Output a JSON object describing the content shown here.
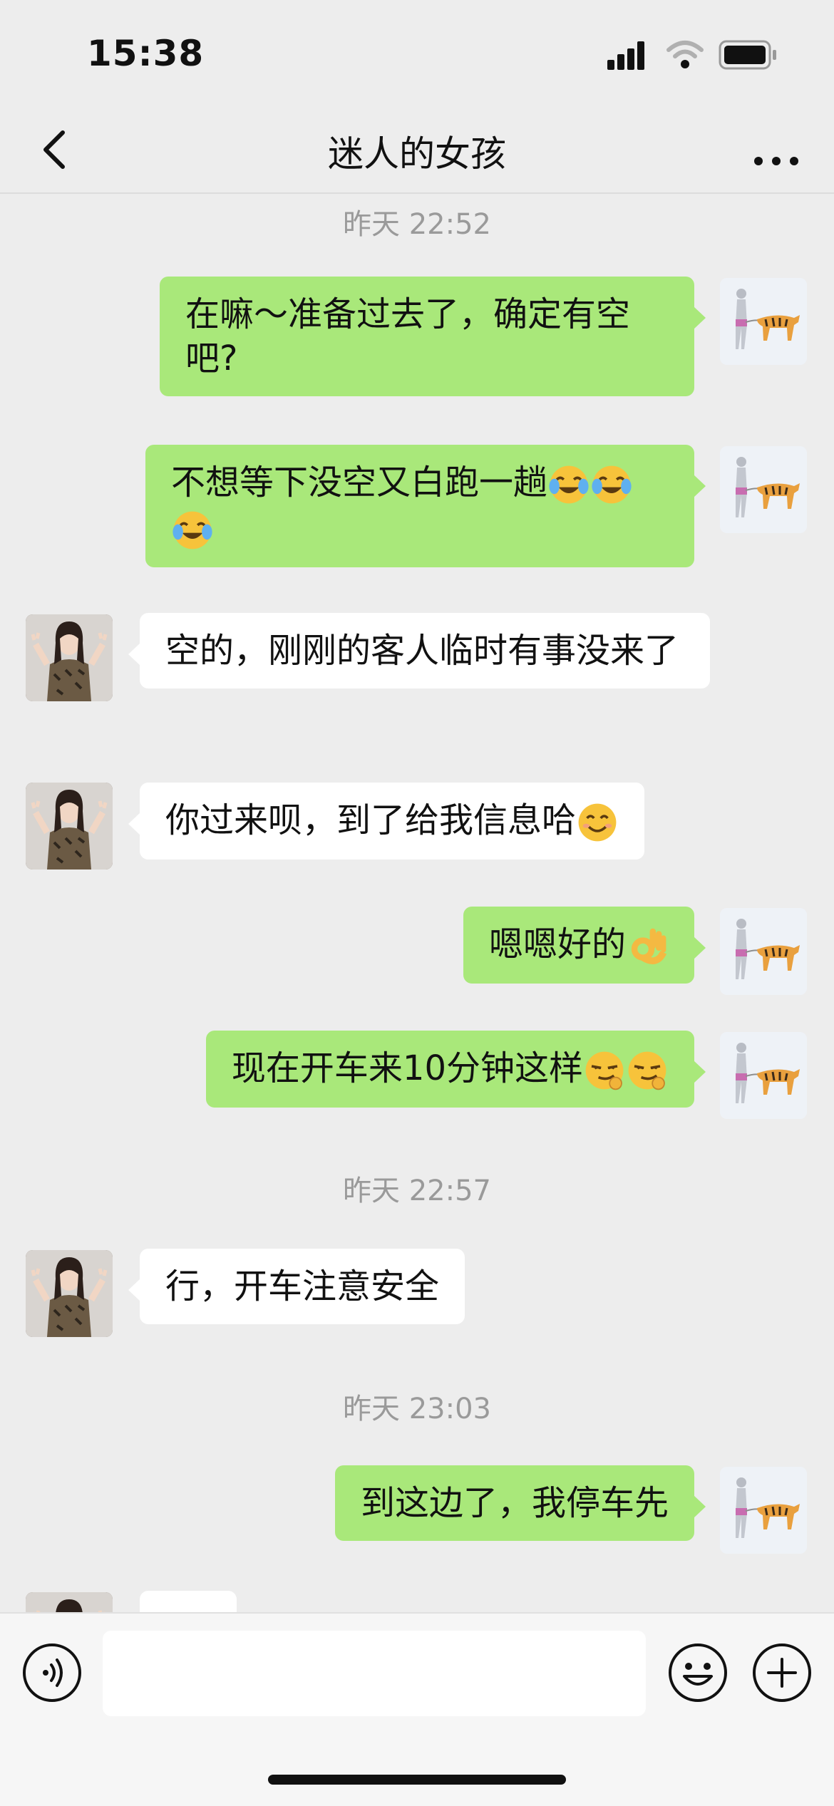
{
  "status_bar": {
    "time": "15:38",
    "signal_icon": "signal-bars-icon",
    "wifi_icon": "wifi-icon",
    "battery_icon": "battery-icon"
  },
  "header": {
    "title": "迷人的女孩",
    "back_icon": "chevron-left-icon",
    "more_icon": "more-dots-icon"
  },
  "timestamps": [
    "昨天 22:52",
    "昨天 22:57",
    "昨天 23:03"
  ],
  "messages": [
    {
      "from": "me",
      "text": "在嘛～准备过去了，确定有空吧?"
    },
    {
      "from": "me",
      "text": "不想等下没空又白跑一趟",
      "emoji": [
        "crying-laughing-emoji",
        "crying-laughing-emoji",
        "crying-laughing-emoji"
      ]
    },
    {
      "from": "her",
      "text": "空的，刚刚的客人临时有事没来了"
    },
    {
      "from": "her",
      "text": "你过来呗，到了给我信息哈",
      "emoji": [
        "smiling-face-emoji"
      ]
    },
    {
      "from": "me",
      "text": "嗯嗯好的",
      "emoji": [
        "ok-hand-emoji"
      ]
    },
    {
      "from": "me",
      "text": "现在开车来10分钟这样",
      "emoji": [
        "smirk-emoji",
        "smirk-emoji"
      ]
    },
    {
      "from": "her",
      "text": "行，开车注意安全"
    },
    {
      "from": "me",
      "text": "到这边了，我停车先"
    }
  ],
  "input_bar": {
    "voice_icon": "voice-icon",
    "input_value": "",
    "emoji_icon": "emoji-smile-icon",
    "plus_icon": "plus-circle-icon"
  },
  "colors": {
    "my_bubble": "#a9e87a",
    "her_bubble": "#ffffff",
    "background": "#ededed"
  }
}
